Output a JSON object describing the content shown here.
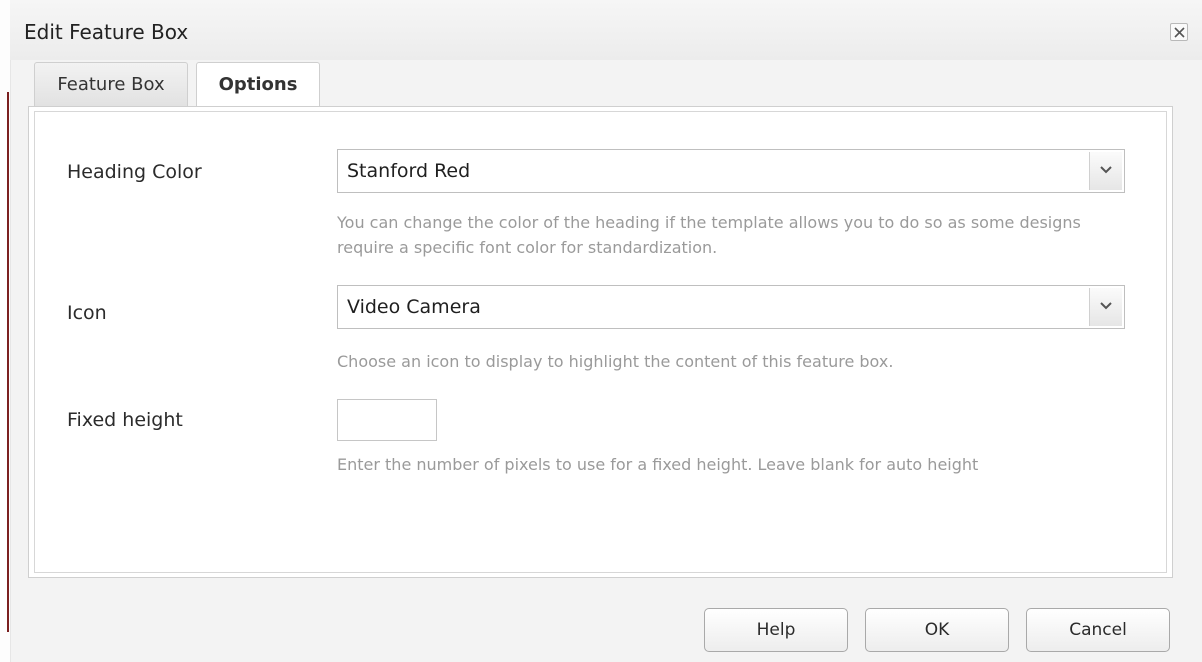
{
  "dialog": {
    "title": "Edit Feature Box",
    "close_icon": "close-x-icon"
  },
  "tabs": [
    {
      "label": "Feature Box",
      "active": false
    },
    {
      "label": "Options",
      "active": true
    }
  ],
  "fields": {
    "heading_color": {
      "label": "Heading Color",
      "value": "Stanford Red",
      "hint": "You can change the color of the heading if the template allows you to do so as some designs require a specific font color for standardization."
    },
    "icon": {
      "label": "Icon",
      "value": "Video Camera",
      "hint": "Choose an icon to display to highlight the content of this feature box."
    },
    "fixed_height": {
      "label": "Fixed height",
      "value": "",
      "hint": "Enter the number of pixels to use for a fixed height. Leave blank for auto height"
    }
  },
  "buttons": {
    "help": "Help",
    "ok": "OK",
    "cancel": "Cancel"
  },
  "icons": {
    "dropdown": "chevron-down-icon"
  }
}
